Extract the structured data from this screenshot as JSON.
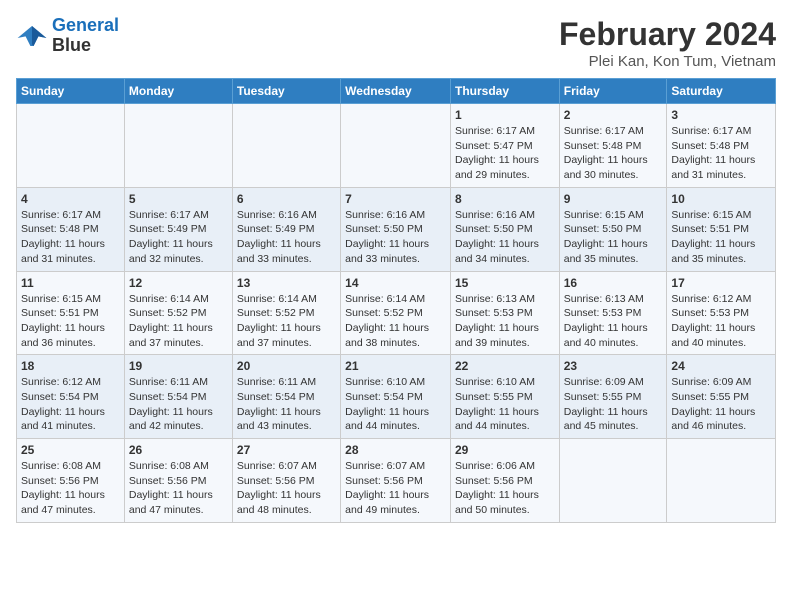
{
  "logo": {
    "line1": "General",
    "line2": "Blue"
  },
  "title": "February 2024",
  "subtitle": "Plei Kan, Kon Tum, Vietnam",
  "days_of_week": [
    "Sunday",
    "Monday",
    "Tuesday",
    "Wednesday",
    "Thursday",
    "Friday",
    "Saturday"
  ],
  "weeks": [
    [
      {
        "day": "",
        "info": ""
      },
      {
        "day": "",
        "info": ""
      },
      {
        "day": "",
        "info": ""
      },
      {
        "day": "",
        "info": ""
      },
      {
        "day": "1",
        "info": "Sunrise: 6:17 AM\nSunset: 5:47 PM\nDaylight: 11 hours and 29 minutes."
      },
      {
        "day": "2",
        "info": "Sunrise: 6:17 AM\nSunset: 5:48 PM\nDaylight: 11 hours and 30 minutes."
      },
      {
        "day": "3",
        "info": "Sunrise: 6:17 AM\nSunset: 5:48 PM\nDaylight: 11 hours and 31 minutes."
      }
    ],
    [
      {
        "day": "4",
        "info": "Sunrise: 6:17 AM\nSunset: 5:48 PM\nDaylight: 11 hours and 31 minutes."
      },
      {
        "day": "5",
        "info": "Sunrise: 6:17 AM\nSunset: 5:49 PM\nDaylight: 11 hours and 32 minutes."
      },
      {
        "day": "6",
        "info": "Sunrise: 6:16 AM\nSunset: 5:49 PM\nDaylight: 11 hours and 33 minutes."
      },
      {
        "day": "7",
        "info": "Sunrise: 6:16 AM\nSunset: 5:50 PM\nDaylight: 11 hours and 33 minutes."
      },
      {
        "day": "8",
        "info": "Sunrise: 6:16 AM\nSunset: 5:50 PM\nDaylight: 11 hours and 34 minutes."
      },
      {
        "day": "9",
        "info": "Sunrise: 6:15 AM\nSunset: 5:50 PM\nDaylight: 11 hours and 35 minutes."
      },
      {
        "day": "10",
        "info": "Sunrise: 6:15 AM\nSunset: 5:51 PM\nDaylight: 11 hours and 35 minutes."
      }
    ],
    [
      {
        "day": "11",
        "info": "Sunrise: 6:15 AM\nSunset: 5:51 PM\nDaylight: 11 hours and 36 minutes."
      },
      {
        "day": "12",
        "info": "Sunrise: 6:14 AM\nSunset: 5:52 PM\nDaylight: 11 hours and 37 minutes."
      },
      {
        "day": "13",
        "info": "Sunrise: 6:14 AM\nSunset: 5:52 PM\nDaylight: 11 hours and 37 minutes."
      },
      {
        "day": "14",
        "info": "Sunrise: 6:14 AM\nSunset: 5:52 PM\nDaylight: 11 hours and 38 minutes."
      },
      {
        "day": "15",
        "info": "Sunrise: 6:13 AM\nSunset: 5:53 PM\nDaylight: 11 hours and 39 minutes."
      },
      {
        "day": "16",
        "info": "Sunrise: 6:13 AM\nSunset: 5:53 PM\nDaylight: 11 hours and 40 minutes."
      },
      {
        "day": "17",
        "info": "Sunrise: 6:12 AM\nSunset: 5:53 PM\nDaylight: 11 hours and 40 minutes."
      }
    ],
    [
      {
        "day": "18",
        "info": "Sunrise: 6:12 AM\nSunset: 5:54 PM\nDaylight: 11 hours and 41 minutes."
      },
      {
        "day": "19",
        "info": "Sunrise: 6:11 AM\nSunset: 5:54 PM\nDaylight: 11 hours and 42 minutes."
      },
      {
        "day": "20",
        "info": "Sunrise: 6:11 AM\nSunset: 5:54 PM\nDaylight: 11 hours and 43 minutes."
      },
      {
        "day": "21",
        "info": "Sunrise: 6:10 AM\nSunset: 5:54 PM\nDaylight: 11 hours and 44 minutes."
      },
      {
        "day": "22",
        "info": "Sunrise: 6:10 AM\nSunset: 5:55 PM\nDaylight: 11 hours and 44 minutes."
      },
      {
        "day": "23",
        "info": "Sunrise: 6:09 AM\nSunset: 5:55 PM\nDaylight: 11 hours and 45 minutes."
      },
      {
        "day": "24",
        "info": "Sunrise: 6:09 AM\nSunset: 5:55 PM\nDaylight: 11 hours and 46 minutes."
      }
    ],
    [
      {
        "day": "25",
        "info": "Sunrise: 6:08 AM\nSunset: 5:56 PM\nDaylight: 11 hours and 47 minutes."
      },
      {
        "day": "26",
        "info": "Sunrise: 6:08 AM\nSunset: 5:56 PM\nDaylight: 11 hours and 47 minutes."
      },
      {
        "day": "27",
        "info": "Sunrise: 6:07 AM\nSunset: 5:56 PM\nDaylight: 11 hours and 48 minutes."
      },
      {
        "day": "28",
        "info": "Sunrise: 6:07 AM\nSunset: 5:56 PM\nDaylight: 11 hours and 49 minutes."
      },
      {
        "day": "29",
        "info": "Sunrise: 6:06 AM\nSunset: 5:56 PM\nDaylight: 11 hours and 50 minutes."
      },
      {
        "day": "",
        "info": ""
      },
      {
        "day": "",
        "info": ""
      }
    ]
  ]
}
